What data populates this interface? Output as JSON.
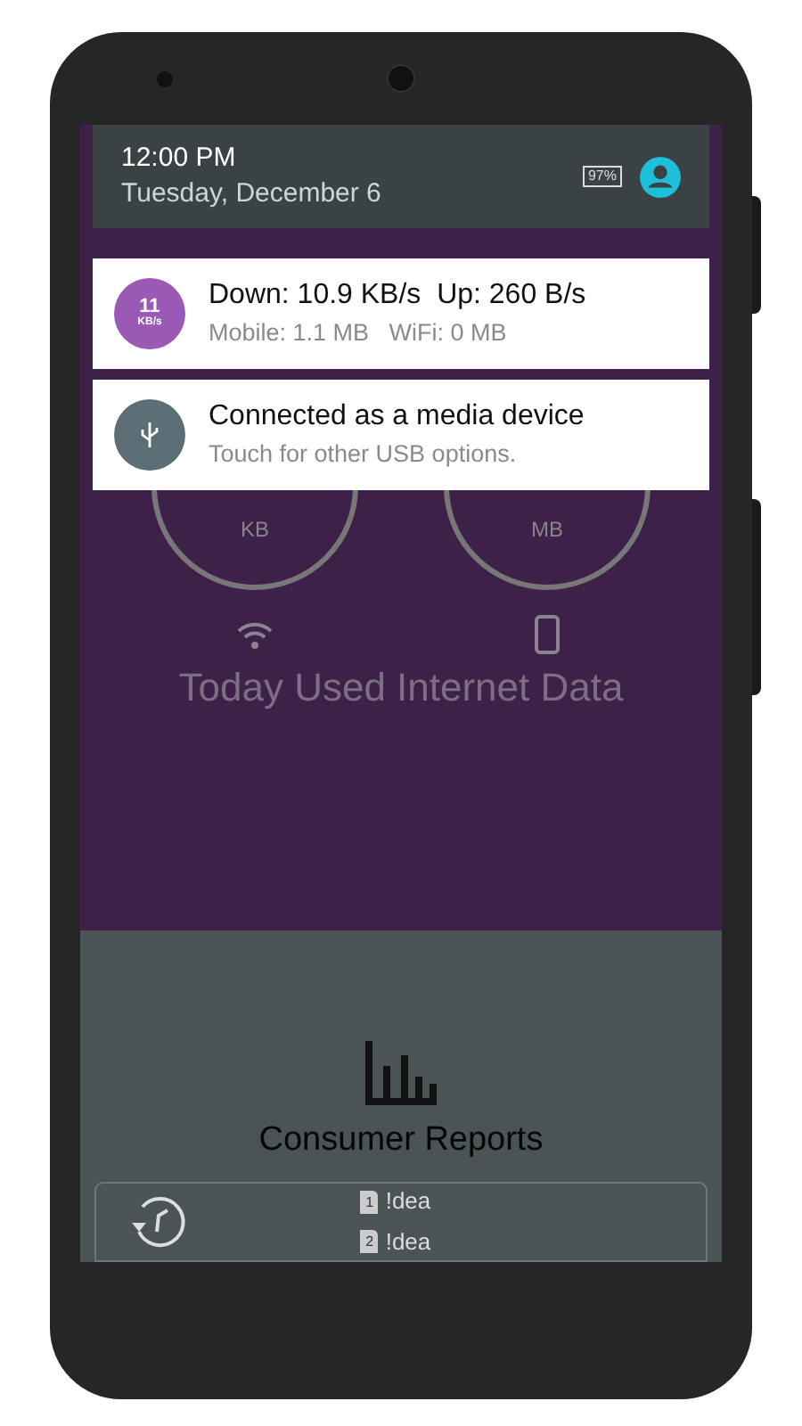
{
  "status_header": {
    "time": "12:00 PM",
    "date": "Tuesday, December 6",
    "battery": "97%"
  },
  "notifications": [
    {
      "kind": "speed",
      "badge_value": "11",
      "badge_unit": "KB/s",
      "title": "Down: 10.9 KB/s  Up: 260 B/s",
      "subtitle": "Mobile: 1.1 MB   WiFi: 0 MB",
      "color": "#9b59b6"
    },
    {
      "kind": "usb",
      "title": "Connected as a media device",
      "subtitle": "Touch for other USB options.",
      "color": "#5b6e76"
    }
  ],
  "gauges": [
    {
      "kind": "wifi",
      "unit": "KB"
    },
    {
      "kind": "mobile",
      "unit": "MB"
    }
  ],
  "usage_title": "Today Used Internet Data",
  "reports_title": "Consumer Reports",
  "sim_card": {
    "sims": [
      {
        "slot": "1",
        "operator": "!dea"
      },
      {
        "slot": "2",
        "operator": "!dea"
      }
    ]
  }
}
